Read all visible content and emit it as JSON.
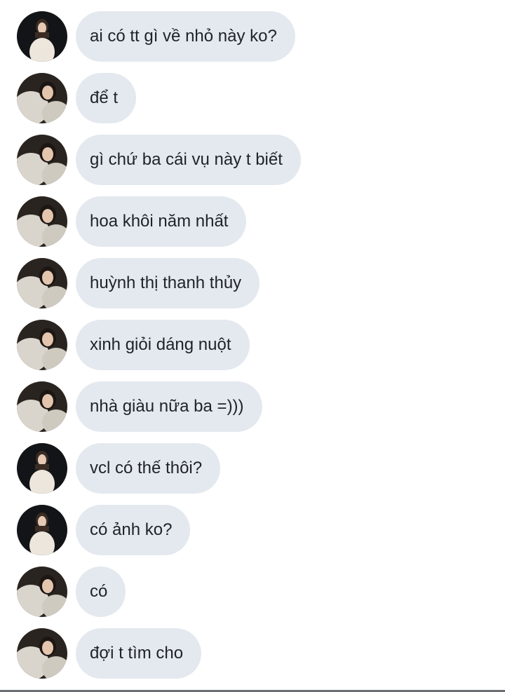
{
  "messages": [
    {
      "avatar": "avatar-dark-coat",
      "text": "ai có tt gì về nhỏ này ko?"
    },
    {
      "avatar": "avatar-fur-coat",
      "text": "để t"
    },
    {
      "avatar": "avatar-fur-coat",
      "text": "gì chứ ba cái vụ này t biết"
    },
    {
      "avatar": "avatar-fur-coat",
      "text": "hoa khôi năm nhất"
    },
    {
      "avatar": "avatar-fur-coat",
      "text": "huỳnh thị thanh thủy"
    },
    {
      "avatar": "avatar-fur-coat",
      "text": "xinh giỏi dáng nuột"
    },
    {
      "avatar": "avatar-fur-coat",
      "text": "nhà giàu nữa ba =)))"
    },
    {
      "avatar": "avatar-dark-coat",
      "text": "vcl có thế thôi?"
    },
    {
      "avatar": "avatar-dark-coat",
      "text": "có ảnh ko?"
    },
    {
      "avatar": "avatar-fur-coat",
      "text": "có"
    },
    {
      "avatar": "avatar-fur-coat",
      "text": "đợi t tìm cho"
    }
  ],
  "colors": {
    "bubble": "#e4e9ef",
    "text": "#1f2328",
    "divider": "#6b6f73"
  }
}
